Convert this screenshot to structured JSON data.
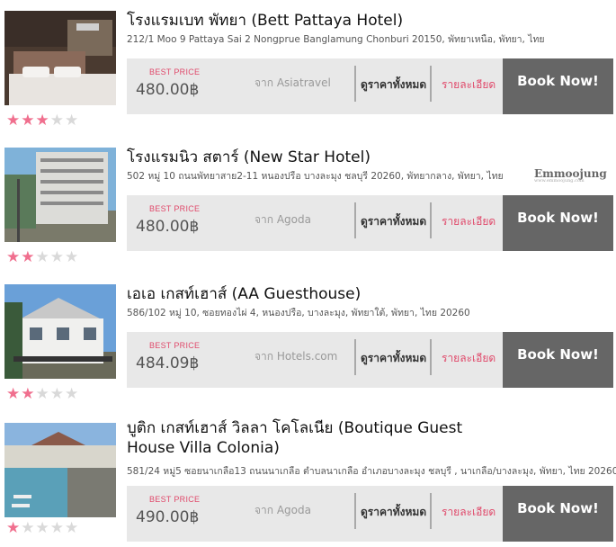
{
  "labels": {
    "best_price": "BEST PRICE",
    "all_prices": "ดูราคาทั้งหมด",
    "details": "รายละเอียด",
    "book": "Book Now!"
  },
  "watermark": {
    "logo_text": "mmoojung",
    "logo_sub": "www.emmoojung.com"
  },
  "colors": {
    "star_on": "#f06f8e",
    "star_off": "#d9d9d9",
    "accent": "#e04a6b",
    "book_bg": "#666666",
    "panel_bg": "#e8e8e8"
  },
  "hotels": [
    {
      "title": "โรงแรมเบท พัทยา (Bett Pattaya Hotel)",
      "address": "212/1 Moo 9 Pattaya Sai 2 Nongprue Banglamung Chonburi 20150, พัทยาเหนือ, พัทยา, ไทย",
      "price": "480.00฿",
      "source": "จาก Asiatravel",
      "stars": 3
    },
    {
      "title": "โรงแรมนิว สตาร์ (New Star Hotel)",
      "address": "502 หมู่ 10 ถนนพัทยาสาย2-11 หนองปรือ บางละมุง ชลบุรี 20260, พัทยากลาง, พัทยา, ไทย",
      "price": "480.00฿",
      "source": "จาก Agoda",
      "stars": 2
    },
    {
      "title": "เอเอ เกสท์เฮาส์ (AA Guesthouse)",
      "address": "586/102 หมู่ 10, ซอยทองไผ่ 4, หนองปรือ, บางละมุง, พัทยาใต้, พัทยา, ไทย 20260",
      "price": "484.09฿",
      "source": "จาก Hotels.com",
      "stars": 2
    },
    {
      "title": "บูติก เกสท์เฮาส์ วิลลา โคโลเนีย (Boutique Guest House Villa Colonia)",
      "address": "581/24 หมู่5 ซอยนาเกลือ13 ถนนนาเกลือ ตำบลนาเกลือ อำเภอบางละมุง ชลบุรี , นาเกลือ/บางละมุง, พัทยา, ไทย 20260",
      "price": "490.00฿",
      "source": "จาก Agoda",
      "stars": 1
    }
  ]
}
